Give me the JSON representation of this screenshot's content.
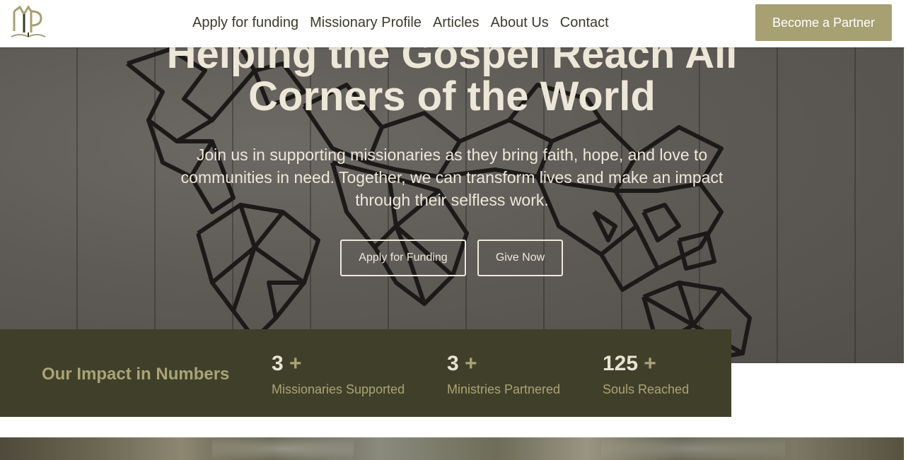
{
  "nav": {
    "logo_alt": "MP logo",
    "links": [
      "Apply for funding",
      "Missionary Profile",
      "Articles",
      "About Us",
      "Contact"
    ],
    "cta": "Become a Partner"
  },
  "hero": {
    "title_line1": "Helping the Gospel Reach All",
    "title_line2": "Corners of the World",
    "subtitle": "Join us in supporting missionaries as they bring faith, hope, and love to communities in need. Together, we can transform lives and make an impact through their selfless work.",
    "buttons": {
      "apply": "Apply for Funding",
      "give": "Give Now"
    },
    "background": "world-map-icon"
  },
  "impact": {
    "title": "Our Impact in Numbers",
    "stats": [
      {
        "number": "3",
        "plus": "+",
        "label": "Missionaries Supported"
      },
      {
        "number": "3",
        "plus": "+",
        "label": "Ministries Partnered"
      },
      {
        "number": "125",
        "plus": "+",
        "label": "Souls Reached"
      }
    ]
  },
  "colors": {
    "accent": "#a6a073",
    "impact_bg": "#40402a",
    "nav_text": "#3c3a2a",
    "hero_text": "#ece7d8"
  }
}
